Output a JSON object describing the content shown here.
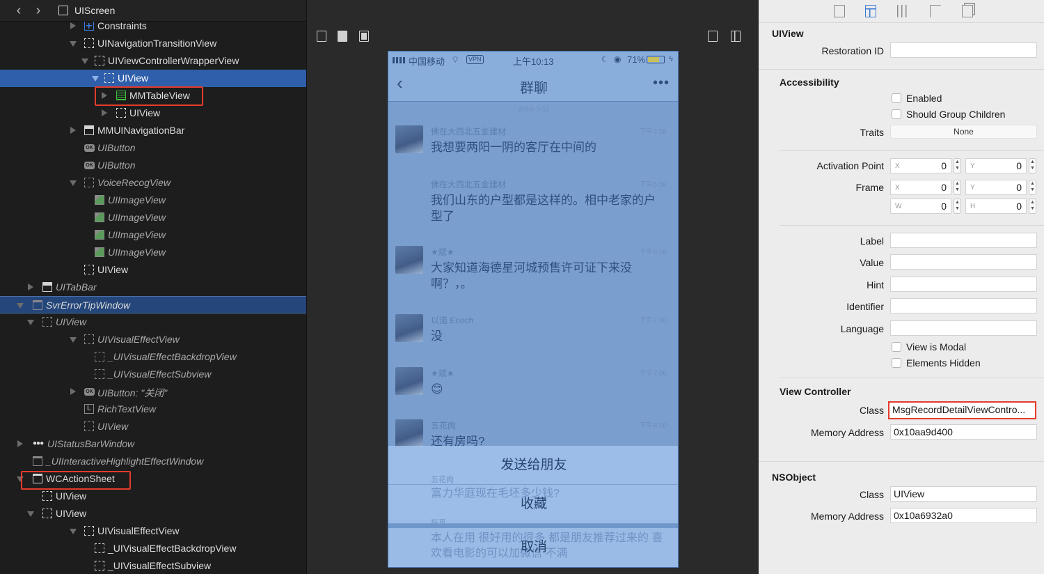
{
  "header": {
    "title": "UIScreen",
    "back": "‹",
    "forward": "›"
  },
  "tree": [
    {
      "label": "Constraints",
      "icon": "constraints",
      "indent": 1
    },
    {
      "label": "UINavigationTransitionView",
      "icon": "view",
      "indent": 1
    },
    {
      "label": "UIViewControllerWrapperView",
      "icon": "view",
      "indent": 2
    },
    {
      "label": "UIView",
      "icon": "view",
      "indent": 3
    },
    {
      "label": "MMTableView",
      "icon": "table",
      "indent": 4
    },
    {
      "label": "UIView",
      "icon": "view",
      "indent": 4
    },
    {
      "label": "MMUINavigationBar",
      "icon": "navbar",
      "indent": 1
    },
    {
      "label": "UIButton",
      "icon": "button",
      "indent": 1
    },
    {
      "label": "UIButton",
      "icon": "button",
      "indent": 1
    },
    {
      "label": "VoiceRecogView",
      "icon": "view",
      "indent": 1
    },
    {
      "label": "UIImageView",
      "icon": "image",
      "indent": 2
    },
    {
      "label": "UIImageView",
      "icon": "image",
      "indent": 2
    },
    {
      "label": "UIImageView",
      "icon": "image",
      "indent": 2
    },
    {
      "label": "UIImageView",
      "icon": "image",
      "indent": 2
    },
    {
      "label": "UIView",
      "icon": "view",
      "indent": 1
    },
    {
      "label": "UITabBar",
      "icon": "navbar",
      "indent": 0
    },
    {
      "label": "SvrErrorTipWindow",
      "icon": "window",
      "indent": -1
    },
    {
      "label": "UIView",
      "icon": "view",
      "indent": 0
    },
    {
      "label": "UIVisualEffectView",
      "icon": "view",
      "indent": 1
    },
    {
      "label": "_UIVisualEffectBackdropView",
      "icon": "view",
      "indent": 2
    },
    {
      "label": "_UIVisualEffectSubview",
      "icon": "view",
      "indent": 2
    },
    {
      "label": "UIButton: \"关闭\"",
      "icon": "button",
      "indent": 1
    },
    {
      "label": "RichTextView",
      "icon": "label",
      "indent": 1
    },
    {
      "label": "UIView",
      "icon": "view",
      "indent": 1
    },
    {
      "label": "UIStatusBarWindow",
      "icon": "dots",
      "indent": -1
    },
    {
      "label": "_UIInteractiveHighlightEffectWindow",
      "icon": "window",
      "indent": -1
    },
    {
      "label": "WCActionSheet",
      "icon": "window",
      "indent": -1
    },
    {
      "label": "UIView",
      "icon": "view",
      "indent": 0
    },
    {
      "label": "UIView",
      "icon": "view",
      "indent": 0
    },
    {
      "label": "UIVisualEffectView",
      "icon": "view",
      "indent": 1
    },
    {
      "label": "_UIVisualEffectBackdropView",
      "icon": "view",
      "indent": 2
    },
    {
      "label": "_UIVisualEffectSubview",
      "icon": "view",
      "indent": 2
    }
  ],
  "phone": {
    "status": {
      "carrier": "中国移动",
      "vpn": "VPN",
      "time": "上午10:13",
      "battery": "71%",
      "battery_level": 0.71
    },
    "nav": {
      "back": "‹",
      "title": "群聊",
      "more": "•••"
    },
    "date": "2016-3-11",
    "messages": [
      {
        "name": "佛在大西北五金建材",
        "time": "下午3:58",
        "text": "我想要两阳一阴的客厅在中间的"
      },
      {
        "name": "佛在大西北五金建材",
        "time": "下午5:59",
        "text": "我们山东的户型都是这样的。相中老家的户型了"
      },
      {
        "name": "★斌★",
        "time": "下午6:56",
        "text": "大家知道海德星河城预售许可证下来没啊？，。"
      },
      {
        "name": "以诺 Enoch",
        "time": "下午7:00",
        "text": "没"
      },
      {
        "name": "★斌★",
        "time": "下午7:06",
        "text": "😊"
      },
      {
        "name": "五花肉",
        "time": "下午8:00",
        "text": "还有房吗?"
      }
    ],
    "sheet": [
      {
        "label": "发送给朋友",
        "ghost": ""
      },
      {
        "label": "收藏",
        "ghost": "富力华庭现在毛坯多少钱?",
        "ghost_name": "五花肉"
      },
      {
        "label": "取消",
        "ghost": "本人在用 很好用的很多 都是朋友推荐过来的 喜欢看电影的可以加微信 不满",
        "ghost_name": "狂觅"
      }
    ]
  },
  "inspector": {
    "uiview": {
      "title": "UIView",
      "restoration_id_label": "Restoration ID",
      "restoration_id": ""
    },
    "accessibility": {
      "title": "Accessibility",
      "enabled": "Enabled",
      "group": "Should Group Children",
      "traits_label": "Traits",
      "traits": "None",
      "activation_label": "Activation Point",
      "frame_label": "Frame",
      "x": "X",
      "y": "Y",
      "w": "W",
      "h": "H",
      "ap_x": "0",
      "ap_y": "0",
      "fr_x": "0",
      "fr_y": "0",
      "fr_w": "0",
      "fr_h": "0",
      "label_label": "Label",
      "value_label": "Value",
      "hint_label": "Hint",
      "identifier_label": "Identifier",
      "language_label": "Language",
      "modal": "View is Modal",
      "hidden": "Elements Hidden"
    },
    "view_controller": {
      "title": "View Controller",
      "class_label": "Class",
      "class_value": "MsgRecordDetailViewContro...",
      "memory_label": "Memory Address",
      "memory_value": "0x10aa9d400"
    },
    "nsobject": {
      "title": "NSObject",
      "class_label": "Class",
      "class_value": "UIView",
      "memory_label": "Memory Address",
      "memory_value": "0x10a6932a0"
    }
  },
  "colors": {
    "selection": "#2f5fab",
    "highlight_box": "#e43b2c",
    "phone_tint": "#6f97c9"
  }
}
